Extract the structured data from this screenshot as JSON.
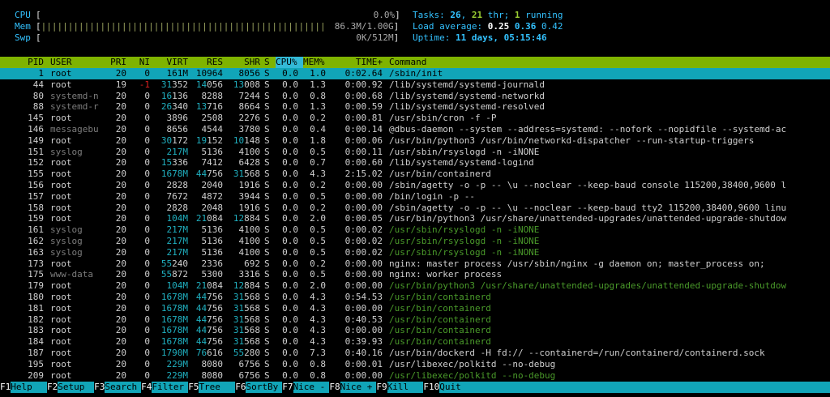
{
  "meters": {
    "cpu": {
      "label": "CPU",
      "value": "0.0%"
    },
    "mem": {
      "label": "Mem",
      "bars": "||||||||||||||||||||||||||||||||||||||||||||||||||||||||||||||||||||||||",
      "value": "86.3M/1.00G"
    },
    "swp": {
      "label": "Swp",
      "value": "0K/512M"
    }
  },
  "stats": {
    "tasks_label": "Tasks:",
    "tasks": "26",
    "thr": "21",
    "thr_label": "thr;",
    "running": "1",
    "running_label": "running",
    "load_label": "Load average:",
    "load1": "0.25",
    "load5": "0.36",
    "load15": "0.42",
    "uptime_label": "Uptime:",
    "uptime": "11 days, 05:15:46"
  },
  "header": {
    "pid": "PID",
    "user": "USER",
    "pri": "PRI",
    "ni": "NI",
    "virt": "VIRT",
    "res": "RES",
    "shr": "SHR",
    "s": "S",
    "cpu": "CPU%",
    "mem": "MEM%",
    "time": "TIME+",
    "command": "Command"
  },
  "processes": [
    {
      "pid": "1",
      "user": "root",
      "pri": "20",
      "ni": "0",
      "virt": "161M",
      "res": "10964",
      "shr": "8056",
      "s": "S",
      "cpu": "0.0",
      "mem": "1.0",
      "time": "0:02.64",
      "command": "/sbin/init",
      "style": "selected"
    },
    {
      "pid": "44",
      "user": "root",
      "pri": "19",
      "ni": "-1",
      "virt": "31352",
      "res": "14056",
      "shr": "13008",
      "s": "S",
      "cpu": "0.0",
      "mem": "1.3",
      "time": "0:00.92",
      "command": "/lib/systemd/systemd-journald",
      "style": ""
    },
    {
      "pid": "80",
      "user": "systemd-n",
      "pri": "20",
      "ni": "0",
      "virt": "16136",
      "res": "8288",
      "shr": "7244",
      "s": "S",
      "cpu": "0.0",
      "mem": "0.8",
      "time": "0:00.68",
      "command": "/lib/systemd/systemd-networkd",
      "style": ""
    },
    {
      "pid": "88",
      "user": "systemd-r",
      "pri": "20",
      "ni": "0",
      "virt": "26340",
      "res": "13716",
      "shr": "8664",
      "s": "S",
      "cpu": "0.0",
      "mem": "1.3",
      "time": "0:00.59",
      "command": "/lib/systemd/systemd-resolved",
      "style": ""
    },
    {
      "pid": "145",
      "user": "root",
      "pri": "20",
      "ni": "0",
      "virt": "3896",
      "res": "2508",
      "shr": "2276",
      "s": "S",
      "cpu": "0.0",
      "mem": "0.2",
      "time": "0:00.81",
      "command": "/usr/sbin/cron -f -P",
      "style": ""
    },
    {
      "pid": "146",
      "user": "messagebu",
      "pri": "20",
      "ni": "0",
      "virt": "8656",
      "res": "4544",
      "shr": "3780",
      "s": "S",
      "cpu": "0.0",
      "mem": "0.4",
      "time": "0:00.14",
      "command": "@dbus-daemon --system --address=systemd: --nofork --nopidfile --systemd-ac",
      "style": ""
    },
    {
      "pid": "149",
      "user": "root",
      "pri": "20",
      "ni": "0",
      "virt": "30172",
      "res": "19152",
      "shr": "10148",
      "s": "S",
      "cpu": "0.0",
      "mem": "1.8",
      "time": "0:00.06",
      "command": "/usr/bin/python3 /usr/bin/networkd-dispatcher --run-startup-triggers",
      "style": ""
    },
    {
      "pid": "151",
      "user": "syslog",
      "pri": "20",
      "ni": "0",
      "virt": "217M",
      "res": "5136",
      "shr": "4100",
      "s": "S",
      "cpu": "0.0",
      "mem": "0.5",
      "time": "0:00.11",
      "command": "/usr/sbin/rsyslogd -n -iNONE",
      "style": ""
    },
    {
      "pid": "152",
      "user": "root",
      "pri": "20",
      "ni": "0",
      "virt": "15336",
      "res": "7412",
      "shr": "6428",
      "s": "S",
      "cpu": "0.0",
      "mem": "0.7",
      "time": "0:00.60",
      "command": "/lib/systemd/systemd-logind",
      "style": ""
    },
    {
      "pid": "155",
      "user": "root",
      "pri": "20",
      "ni": "0",
      "virt": "1678M",
      "res": "44756",
      "shr": "31568",
      "s": "S",
      "cpu": "0.0",
      "mem": "4.3",
      "time": "2:15.02",
      "command": "/usr/bin/containerd",
      "style": ""
    },
    {
      "pid": "156",
      "user": "root",
      "pri": "20",
      "ni": "0",
      "virt": "2828",
      "res": "2040",
      "shr": "1916",
      "s": "S",
      "cpu": "0.0",
      "mem": "0.2",
      "time": "0:00.00",
      "command": "/sbin/agetty -o -p -- \\u --noclear --keep-baud console 115200,38400,9600 l",
      "style": ""
    },
    {
      "pid": "157",
      "user": "root",
      "pri": "20",
      "ni": "0",
      "virt": "7672",
      "res": "4872",
      "shr": "3944",
      "s": "S",
      "cpu": "0.0",
      "mem": "0.5",
      "time": "0:00.00",
      "command": "/bin/login -p --",
      "style": ""
    },
    {
      "pid": "158",
      "user": "root",
      "pri": "20",
      "ni": "0",
      "virt": "2828",
      "res": "2048",
      "shr": "1916",
      "s": "S",
      "cpu": "0.0",
      "mem": "0.2",
      "time": "0:00.00",
      "command": "/sbin/agetty -o -p -- \\u --noclear --keep-baud tty2 115200,38400,9600 linu",
      "style": ""
    },
    {
      "pid": "159",
      "user": "root",
      "pri": "20",
      "ni": "0",
      "virt": "104M",
      "res": "21084",
      "shr": "12884",
      "s": "S",
      "cpu": "0.0",
      "mem": "2.0",
      "time": "0:00.05",
      "command": "/usr/bin/python3 /usr/share/unattended-upgrades/unattended-upgrade-shutdow",
      "style": ""
    },
    {
      "pid": "161",
      "user": "syslog",
      "pri": "20",
      "ni": "0",
      "virt": "217M",
      "res": "5136",
      "shr": "4100",
      "s": "S",
      "cpu": "0.0",
      "mem": "0.5",
      "time": "0:00.02",
      "command": "/usr/sbin/rsyslogd -n -iNONE",
      "style": "thread"
    },
    {
      "pid": "162",
      "user": "syslog",
      "pri": "20",
      "ni": "0",
      "virt": "217M",
      "res": "5136",
      "shr": "4100",
      "s": "S",
      "cpu": "0.0",
      "mem": "0.5",
      "time": "0:00.02",
      "command": "/usr/sbin/rsyslogd -n -iNONE",
      "style": "thread"
    },
    {
      "pid": "163",
      "user": "syslog",
      "pri": "20",
      "ni": "0",
      "virt": "217M",
      "res": "5136",
      "shr": "4100",
      "s": "S",
      "cpu": "0.0",
      "mem": "0.5",
      "time": "0:00.02",
      "command": "/usr/sbin/rsyslogd -n -iNONE",
      "style": "thread"
    },
    {
      "pid": "173",
      "user": "root",
      "pri": "20",
      "ni": "0",
      "virt": "55240",
      "res": "2336",
      "shr": "692",
      "s": "S",
      "cpu": "0.0",
      "mem": "0.2",
      "time": "0:00.00",
      "command": "nginx: master process /usr/sbin/nginx -g daemon on; master_process on;",
      "style": ""
    },
    {
      "pid": "175",
      "user": "www-data",
      "pri": "20",
      "ni": "0",
      "virt": "55872",
      "res": "5300",
      "shr": "3316",
      "s": "S",
      "cpu": "0.0",
      "mem": "0.5",
      "time": "0:00.00",
      "command": "nginx: worker process",
      "style": ""
    },
    {
      "pid": "179",
      "user": "root",
      "pri": "20",
      "ni": "0",
      "virt": "104M",
      "res": "21084",
      "shr": "12884",
      "s": "S",
      "cpu": "0.0",
      "mem": "2.0",
      "time": "0:00.00",
      "command": "/usr/bin/python3 /usr/share/unattended-upgrades/unattended-upgrade-shutdow",
      "style": "thread"
    },
    {
      "pid": "180",
      "user": "root",
      "pri": "20",
      "ni": "0",
      "virt": "1678M",
      "res": "44756",
      "shr": "31568",
      "s": "S",
      "cpu": "0.0",
      "mem": "4.3",
      "time": "0:54.53",
      "command": "/usr/bin/containerd",
      "style": "thread"
    },
    {
      "pid": "181",
      "user": "root",
      "pri": "20",
      "ni": "0",
      "virt": "1678M",
      "res": "44756",
      "shr": "31568",
      "s": "S",
      "cpu": "0.0",
      "mem": "4.3",
      "time": "0:00.00",
      "command": "/usr/bin/containerd",
      "style": "thread"
    },
    {
      "pid": "182",
      "user": "root",
      "pri": "20",
      "ni": "0",
      "virt": "1678M",
      "res": "44756",
      "shr": "31568",
      "s": "S",
      "cpu": "0.0",
      "mem": "4.3",
      "time": "0:40.53",
      "command": "/usr/bin/containerd",
      "style": "thread"
    },
    {
      "pid": "183",
      "user": "root",
      "pri": "20",
      "ni": "0",
      "virt": "1678M",
      "res": "44756",
      "shr": "31568",
      "s": "S",
      "cpu": "0.0",
      "mem": "4.3",
      "time": "0:00.00",
      "command": "/usr/bin/containerd",
      "style": "thread"
    },
    {
      "pid": "184",
      "user": "root",
      "pri": "20",
      "ni": "0",
      "virt": "1678M",
      "res": "44756",
      "shr": "31568",
      "s": "S",
      "cpu": "0.0",
      "mem": "4.3",
      "time": "0:39.93",
      "command": "/usr/bin/containerd",
      "style": "thread"
    },
    {
      "pid": "187",
      "user": "root",
      "pri": "20",
      "ni": "0",
      "virt": "1790M",
      "res": "76616",
      "shr": "55280",
      "s": "S",
      "cpu": "0.0",
      "mem": "7.3",
      "time": "0:40.16",
      "command": "/usr/bin/dockerd -H fd:// --containerd=/run/containerd/containerd.sock",
      "style": ""
    },
    {
      "pid": "195",
      "user": "root",
      "pri": "20",
      "ni": "0",
      "virt": "229M",
      "res": "8080",
      "shr": "6756",
      "s": "S",
      "cpu": "0.0",
      "mem": "0.8",
      "time": "0:00.01",
      "command": "/usr/libexec/polkitd --no-debug",
      "style": ""
    },
    {
      "pid": "209",
      "user": "root",
      "pri": "20",
      "ni": "0",
      "virt": "229M",
      "res": "8080",
      "shr": "6756",
      "s": "S",
      "cpu": "0.0",
      "mem": "0.8",
      "time": "0:00.00",
      "command": "/usr/libexec/polkitd --no-debug",
      "style": "thread"
    }
  ],
  "fkeys": [
    {
      "key": "F1",
      "label": "Help"
    },
    {
      "key": "F2",
      "label": "Setup"
    },
    {
      "key": "F3",
      "label": "Search"
    },
    {
      "key": "F4",
      "label": "Filter"
    },
    {
      "key": "F5",
      "label": "Tree"
    },
    {
      "key": "F6",
      "label": "SortBy"
    },
    {
      "key": "F7",
      "label": "Nice -"
    },
    {
      "key": "F8",
      "label": "Nice +"
    },
    {
      "key": "F9",
      "label": "Kill"
    },
    {
      "key": "F10",
      "label": "Quit"
    }
  ]
}
